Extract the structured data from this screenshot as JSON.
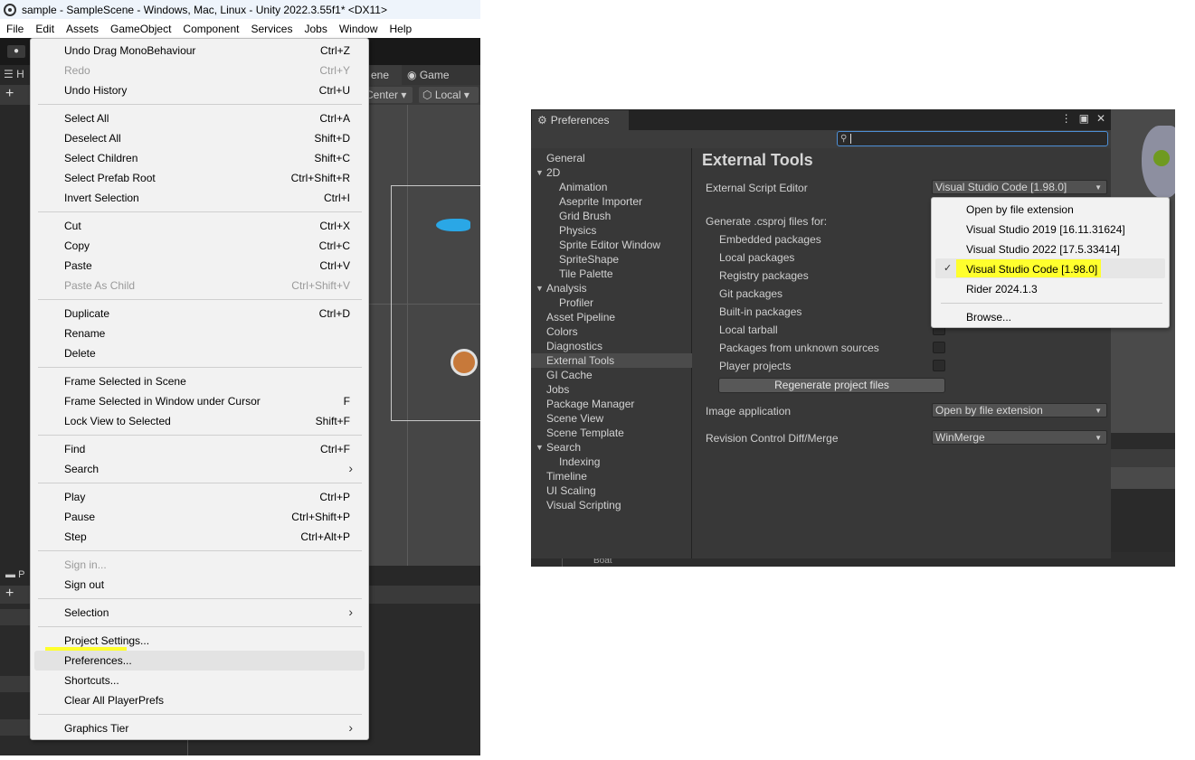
{
  "window": {
    "title": "sample - SampleScene - Windows, Mac, Linux - Unity 2022.3.55f1* <DX11>"
  },
  "menubar": [
    "File",
    "Edit",
    "Assets",
    "GameObject",
    "Component",
    "Services",
    "Jobs",
    "Window",
    "Help"
  ],
  "editor": {
    "hierarchy_tab": "H",
    "scene_tab": "ene",
    "game_tab": "Game",
    "pivot_button": "Center",
    "space_button": "Local",
    "project_tab": "P"
  },
  "edit_menu": {
    "items": [
      {
        "label": "Undo Drag MonoBehaviour",
        "shortcut": "Ctrl+Z"
      },
      {
        "label": "Redo",
        "shortcut": "Ctrl+Y"
      },
      {
        "label": "Undo History",
        "shortcut": "Ctrl+U"
      },
      {
        "label": "Select All",
        "shortcut": "Ctrl+A"
      },
      {
        "label": "Deselect All",
        "shortcut": "Shift+D"
      },
      {
        "label": "Select Children",
        "shortcut": "Shift+C"
      },
      {
        "label": "Select Prefab Root",
        "shortcut": "Ctrl+Shift+R"
      },
      {
        "label": "Invert Selection",
        "shortcut": "Ctrl+I"
      },
      {
        "label": "Cut",
        "shortcut": "Ctrl+X"
      },
      {
        "label": "Copy",
        "shortcut": "Ctrl+C"
      },
      {
        "label": "Paste",
        "shortcut": "Ctrl+V"
      },
      {
        "label": "Paste As Child",
        "shortcut": "Ctrl+Shift+V"
      },
      {
        "label": "Duplicate",
        "shortcut": "Ctrl+D"
      },
      {
        "label": "Rename",
        "shortcut": ""
      },
      {
        "label": "Delete",
        "shortcut": ""
      },
      {
        "label": "Frame Selected in Scene",
        "shortcut": ""
      },
      {
        "label": "Frame Selected in Window under Cursor",
        "shortcut": "F"
      },
      {
        "label": "Lock View to Selected",
        "shortcut": "Shift+F"
      },
      {
        "label": "Find",
        "shortcut": "Ctrl+F"
      },
      {
        "label": "Search",
        "shortcut": ""
      },
      {
        "label": "Play",
        "shortcut": "Ctrl+P"
      },
      {
        "label": "Pause",
        "shortcut": "Ctrl+Shift+P"
      },
      {
        "label": "Step",
        "shortcut": "Ctrl+Alt+P"
      },
      {
        "label": "Sign in...",
        "shortcut": ""
      },
      {
        "label": "Sign out",
        "shortcut": ""
      },
      {
        "label": "Selection",
        "shortcut": ""
      },
      {
        "label": "Project Settings...",
        "shortcut": ""
      },
      {
        "label": "Preferences...",
        "shortcut": ""
      },
      {
        "label": "Shortcuts...",
        "shortcut": ""
      },
      {
        "label": "Clear All PlayerPrefs",
        "shortcut": ""
      },
      {
        "label": "Graphics Tier",
        "shortcut": ""
      }
    ],
    "highlight_color": "#ffff2d"
  },
  "preferences": {
    "tab_title": "Preferences",
    "search_value": "",
    "nav": [
      "General",
      "2D",
      "Animation",
      "Aseprite Importer",
      "Grid Brush",
      "Physics",
      "Sprite Editor Window",
      "SpriteShape",
      "Tile Palette",
      "Analysis",
      "Profiler",
      "Asset Pipeline",
      "Colors",
      "Diagnostics",
      "External Tools",
      "GI Cache",
      "Jobs",
      "Package Manager",
      "Scene View",
      "Scene Template",
      "Search",
      "Indexing",
      "Timeline",
      "UI Scaling",
      "Visual Scripting"
    ],
    "selected_nav": "External Tools",
    "page_title": "External Tools",
    "script_editor_label": "External Script Editor",
    "script_editor_value": "Visual Studio Code [1.98.0]",
    "generate_label": "Generate .csproj files for:",
    "packages": [
      "Embedded packages",
      "Local packages",
      "Registry packages",
      "Git packages",
      "Built-in packages",
      "Local tarball",
      "Packages from unknown sources",
      "Player projects"
    ],
    "regenerate_button": "Regenerate project files",
    "image_app_label": "Image application",
    "image_app_value": "Open by file extension",
    "diff_label": "Revision Control Diff/Merge",
    "diff_value": "WinMerge",
    "editor_options": [
      "Open by file extension",
      "Visual Studio 2019 [16.11.31624]",
      "Visual Studio 2022 [17.5.33414]",
      "Visual Studio Code [1.98.0]",
      "Rider 2024.1.3",
      "Browse..."
    ],
    "background_label": "Boat"
  }
}
